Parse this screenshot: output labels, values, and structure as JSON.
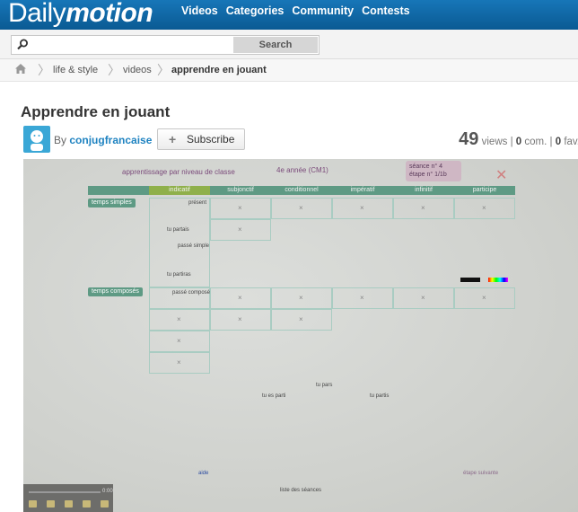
{
  "header": {
    "logo_left": "Daily",
    "logo_right": "motion",
    "nav": [
      "Videos",
      "Categories",
      "Community",
      "Contests"
    ]
  },
  "search": {
    "placeholder": "",
    "button_label": "Search"
  },
  "breadcrumb": [
    "life & style",
    "videos",
    "apprendre en jouant"
  ],
  "video": {
    "title": "Apprendre en jouant",
    "by_label": "By",
    "author": "conjugfrancaise",
    "subscribe_label": "Subscribe",
    "views_count": "49",
    "views_label": "views |",
    "comments_count": "0",
    "comments_label": "com. |",
    "favs_count": "0",
    "favs_label": "fav."
  },
  "frame": {
    "heading_left": "apprentissage par niveau de classe",
    "heading_mid": "4e année (CM1)",
    "seance_line1": "séance n° 4",
    "seance_line2": "étape n° 1/1b",
    "columns": [
      "indicatif",
      "subjonctif",
      "conditionnel",
      "impératif",
      "infinitif",
      "participe"
    ],
    "row_simple": "temps simples",
    "row_compose": "temps composés",
    "sub_present": "présent",
    "sub_passe_simple": "passé simple",
    "sub_passe_compose": "passé composé",
    "word_tu_partais": "tu partais",
    "word_tu_partiras": "tu partiras",
    "word_tu_pars": "tu pars",
    "word_tu_es_parti": "tu es parti",
    "word_tu_partis": "tu partis",
    "link_aide": "aide",
    "link_liste": "liste des séances",
    "link_etape": "étape suivante",
    "cross": "×",
    "time": "0:00"
  }
}
